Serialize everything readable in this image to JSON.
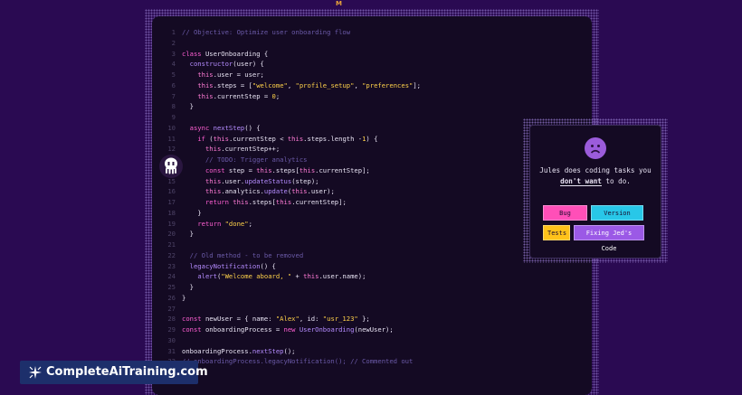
{
  "header": {
    "mark": "M"
  },
  "editor": {
    "lines": [
      {
        "n": "1",
        "html": "<span class='cm'>// Objective: Optimize user onboarding flow</span>"
      },
      {
        "n": "2",
        "html": ""
      },
      {
        "n": "3",
        "html": "<span class='kw'>class</span> UserOnboarding {"
      },
      {
        "n": "4",
        "html": "  <span class='fn'>constructor</span>(user) {"
      },
      {
        "n": "5",
        "html": "    <span class='this'>this</span>.user = user;"
      },
      {
        "n": "6",
        "html": "    <span class='this'>this</span>.steps = [<span class='str'>\"welcome\"</span>, <span class='str'>\"profile_setup\"</span>, <span class='str'>\"preferences\"</span>];"
      },
      {
        "n": "7",
        "html": "    <span class='this'>this</span>.currentStep = <span class='str'>0</span>;"
      },
      {
        "n": "8",
        "html": "  }"
      },
      {
        "n": "9",
        "html": ""
      },
      {
        "n": "10",
        "html": "  <span class='kw'>async</span> <span class='fn'>nextStep</span>() {"
      },
      {
        "n": "11",
        "html": "    <span class='kw'>if</span> (<span class='this'>this</span>.currentStep &lt; <span class='this'>this</span>.steps.length -<span class='str'>1</span>) {"
      },
      {
        "n": "12",
        "html": "      <span class='this'>this</span>.currentStep++;"
      },
      {
        "n": "13",
        "html": "      <span class='cm'>// TODO: Trigger analytics</span>"
      },
      {
        "n": "14",
        "html": "      <span class='kw'>const</span> step = <span class='this'>this</span>.steps[<span class='this'>this</span>.currentStep];"
      },
      {
        "n": "15",
        "html": "      <span class='this'>this</span>.user.<span class='fn'>updateStatus</span>(step);"
      },
      {
        "n": "16",
        "html": "      <span class='this'>this</span>.analytics.<span class='fn'>update</span>(<span class='this'>this</span>.user);"
      },
      {
        "n": "17",
        "html": "      <span class='kw'>return</span> <span class='this'>this</span>.steps[<span class='this'>this</span>.currentStep];"
      },
      {
        "n": "18",
        "html": "    }"
      },
      {
        "n": "19",
        "html": "    <span class='kw'>return</span> <span class='str'>\"done\"</span>;"
      },
      {
        "n": "20",
        "html": "  }"
      },
      {
        "n": "21",
        "html": ""
      },
      {
        "n": "22",
        "html": "  <span class='cm'>// Old method - to be removed</span>"
      },
      {
        "n": "23",
        "html": "  <span class='fn'>legacyNotification</span>() {"
      },
      {
        "n": "24",
        "html": "    <span class='fn'>alert</span>(<span class='str'>\"Welcome aboard, \"</span> + <span class='this'>this</span>.user.name);"
      },
      {
        "n": "25",
        "html": "  }"
      },
      {
        "n": "26",
        "html": "}"
      },
      {
        "n": "27",
        "html": ""
      },
      {
        "n": "28",
        "html": "<span class='kw'>const</span> newUser = { name: <span class='str'>\"Alex\"</span>, id: <span class='str'>\"usr_123\"</span> };"
      },
      {
        "n": "29",
        "html": "<span class='kw'>const</span> onboardingProcess = <span class='kw'>new</span> <span class='fn'>UserOnboarding</span>(newUser);"
      },
      {
        "n": "30",
        "html": ""
      },
      {
        "n": "31",
        "html": "onboardingProcess.<span class='fn'>nextStep</span>();"
      },
      {
        "n": "32",
        "html": "<span class='cm'>// onboardingProcess.legacyNotification(); // Commented out</span>"
      }
    ]
  },
  "panel": {
    "icon": "sad-face-icon",
    "message_before": "Jules does coding tasks you",
    "message_emph": "don't want",
    "message_after": " to do.",
    "tags": {
      "bug_fixing": "Bug Fixing",
      "version_bump": "Version Bump",
      "tests": "Tests",
      "fixing_jeds_code": "Fixing Jed's Code"
    }
  },
  "brand": {
    "icon": "logo-icon",
    "text": "CompleteAiTraining.com"
  },
  "colors": {
    "background": "#2a0a52",
    "editor": "#140a23",
    "keyword": "#ff5fd3",
    "string": "#ffd24a",
    "comment": "#6b5aa8",
    "tag_bug": "#ff4fb8",
    "tag_version": "#28c7e8",
    "tag_tests": "#ffc21a",
    "tag_fix": "#9b59e6"
  }
}
